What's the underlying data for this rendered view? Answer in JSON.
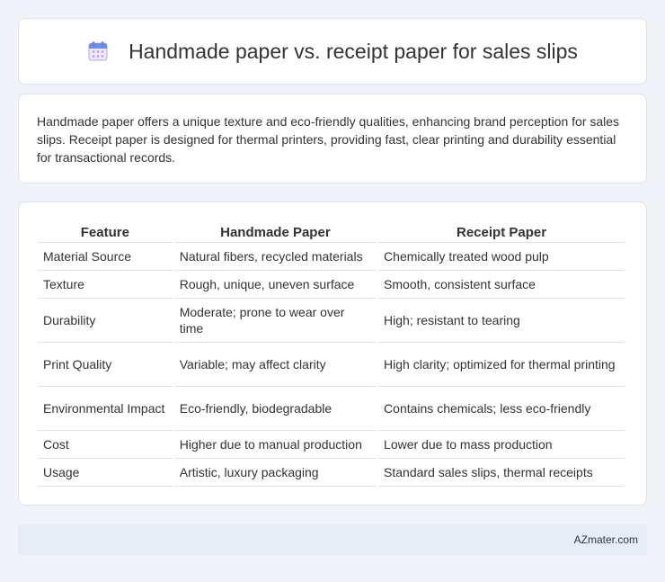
{
  "header": {
    "icon": "calendar-icon",
    "title": "Handmade paper vs. receipt paper for sales slips"
  },
  "intro": {
    "text": "Handmade paper offers a unique texture and eco-friendly qualities, enhancing brand perception for sales slips. Receipt paper is designed for thermal printers, providing fast, clear printing and durability essential for transactional records."
  },
  "table": {
    "headers": [
      "Feature",
      "Handmade Paper",
      "Receipt Paper"
    ],
    "rows": [
      [
        "Material Source",
        "Natural fibers, recycled materials",
        "Chemically treated wood pulp"
      ],
      [
        "Texture",
        "Rough, unique, uneven surface",
        "Smooth, consistent surface"
      ],
      [
        "Durability",
        "Moderate; prone to wear over time",
        "High; resistant to tearing"
      ],
      [
        "Print Quality",
        "Variable; may affect clarity",
        "High clarity; optimized for thermal printing"
      ],
      [
        "Environmental Impact",
        "Eco-friendly, biodegradable",
        "Contains chemicals; less eco-friendly"
      ],
      [
        "Cost",
        "Higher due to manual production",
        "Lower due to mass production"
      ],
      [
        "Usage",
        "Artistic, luxury packaging",
        "Standard sales slips, thermal receipts"
      ]
    ]
  },
  "footer": {
    "text": "AZmater.com"
  },
  "colors": {
    "background": "#f0f3f8",
    "card": "#ffffff",
    "border": "#dde3ec",
    "footer_bg": "#e6edf7",
    "icon_blue": "#6a8fe6",
    "icon_purple": "#b59ae6"
  }
}
